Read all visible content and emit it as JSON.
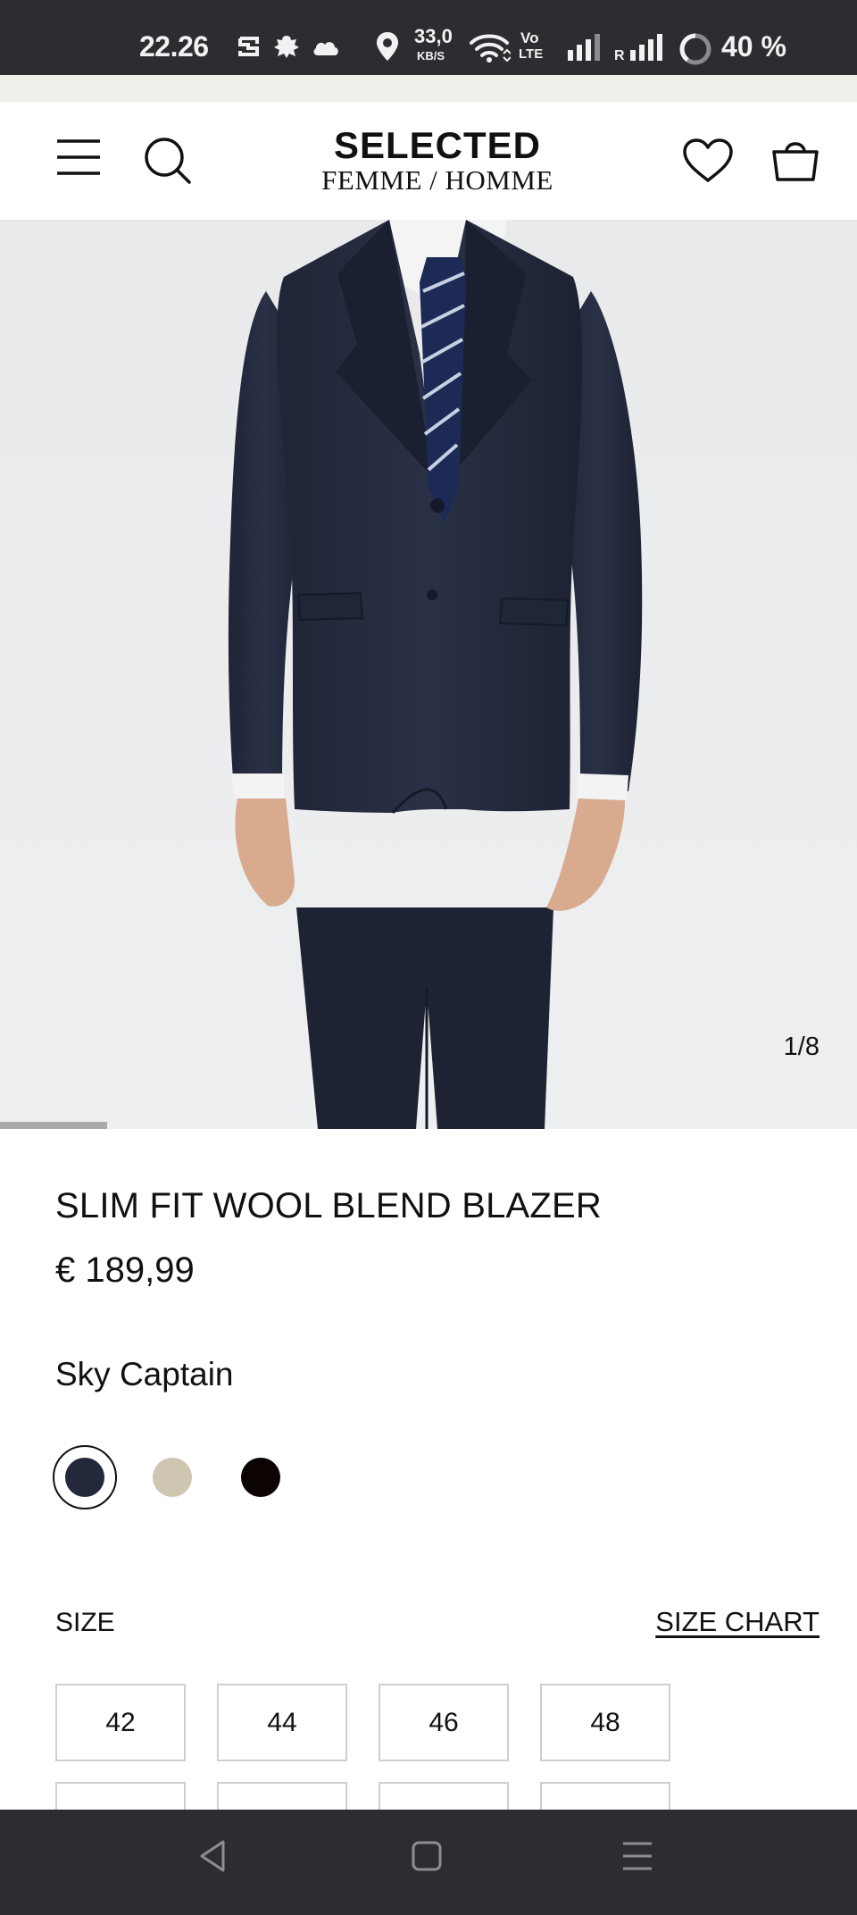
{
  "status_bar": {
    "time": "22.26",
    "network_speed_value": "33,0",
    "network_speed_unit": "KB/S",
    "volte_top": "Vo",
    "volte_bottom": "LTE",
    "roaming": "R",
    "battery": "40 %"
  },
  "header": {
    "logo_main": "SELECTED",
    "logo_sub": "FEMME / HOMME"
  },
  "gallery": {
    "counter": "1/8",
    "current_image": 1,
    "total_images": 8
  },
  "product": {
    "title": "SLIM FIT WOOL BLEND BLAZER",
    "price": "€ 189,99",
    "color_name": "Sky Captain",
    "colors": [
      {
        "hex": "#23293a",
        "selected": true
      },
      {
        "hex": "#cfc6b1",
        "selected": false
      },
      {
        "hex": "#0c0303",
        "selected": false
      }
    ]
  },
  "size": {
    "label": "SIZE",
    "chart_link": "SIZE CHART",
    "options": [
      "42",
      "44",
      "46",
      "48"
    ]
  },
  "theme": {
    "status_bar_bg": "#2b2d31",
    "image_bg": "#ebecee",
    "promo_strip_bg": "#efeee9"
  }
}
